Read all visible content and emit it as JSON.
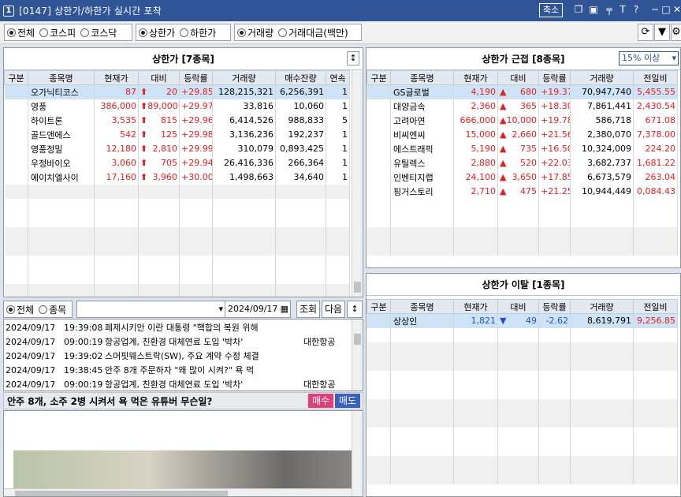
{
  "title": {
    "num": "1",
    "text": "[0147] 상한가/하한가 실시간 포착",
    "shrink": "축소"
  },
  "toolbar": {
    "market": [
      "전체",
      "코스피",
      "코스닥"
    ],
    "kind": [
      "상한가",
      "하한가"
    ],
    "sort": [
      "거래량",
      "거래대금(백만)"
    ]
  },
  "upper": {
    "title": "상한가 [7종목]",
    "cols": [
      "구분",
      "종목명",
      "현재가",
      "대비",
      "등락률",
      "거래량",
      "매수잔량",
      "연속"
    ],
    "rows": [
      [
        "",
        "오가닉티코스",
        "87",
        "20",
        "+29.85",
        "128,215,321",
        "6,256,391",
        "1"
      ],
      [
        "",
        "영풍",
        "386,000",
        "89,000",
        "+29.97",
        "33,816",
        "10,060",
        "1"
      ],
      [
        "",
        "하이트론",
        "3,535",
        "815",
        "+29.96",
        "6,414,526",
        "988,833",
        "5"
      ],
      [
        "",
        "골드앤에스",
        "542",
        "125",
        "+29.98",
        "3,136,236",
        "192,237",
        "1"
      ],
      [
        "",
        "영풍정밀",
        "12,180",
        "2,810",
        "+29.99",
        "310,079",
        "0,893,425",
        "1"
      ],
      [
        "",
        "우정바이오",
        "3,060",
        "705",
        "+29.94",
        "26,416,336",
        "266,364",
        "1"
      ],
      [
        "",
        "에이치엘사이",
        "17,160",
        "3,960",
        "+30.00",
        "1,498,663",
        "34,640",
        "1"
      ]
    ]
  },
  "near": {
    "title": "상한가 근접 [8종목]",
    "filter": "15% 이상",
    "cols": [
      "구분",
      "종목명",
      "현재가",
      "대비",
      "등락률",
      "거래량",
      "전일비"
    ],
    "rows": [
      [
        "",
        "GS글로벌",
        "4,190",
        "680",
        "+19.37",
        "70,947,740",
        "5,455.55"
      ],
      [
        "",
        "대양금속",
        "2,360",
        "365",
        "+18.30",
        "7,861,441",
        "2,430.54"
      ],
      [
        "",
        "고려아연",
        "666,000",
        "10,000",
        "+19.78",
        "586,718",
        "671.08"
      ],
      [
        "",
        "비씨엔씨",
        "15,000",
        "2,660",
        "+21.56",
        "2,380,070",
        "7,378.00"
      ],
      [
        "",
        "에스트래픽",
        "5,190",
        "735",
        "+16.50",
        "10,324,009",
        "224.20"
      ],
      [
        "",
        "유틸렉스",
        "2,880",
        "520",
        "+22.03",
        "3,682,737",
        "1,681.22"
      ],
      [
        "",
        "인벤티지랩",
        "24,100",
        "3,650",
        "+17.85",
        "6,673,579",
        "263.04"
      ],
      [
        "",
        "핑거스토리",
        "2,710",
        "475",
        "+21.25",
        "10,944,449",
        "0,084.43"
      ]
    ]
  },
  "off": {
    "title": "상한가 이탈 [1종목]",
    "cols": [
      "구분",
      "종목명",
      "현재가",
      "대비",
      "등락률",
      "거래량",
      "전일비"
    ],
    "rows": [
      [
        "",
        "상상인",
        "1,821",
        "49",
        "-2.62",
        "8,619,791",
        "9,256.85"
      ]
    ]
  },
  "news": {
    "filter": [
      "전체",
      "종목"
    ],
    "date": "2024/09/17",
    "lookup": "조회",
    "next": "다음",
    "rows": [
      [
        "2024/09/17",
        "19:39:08",
        "페제시키안 이란 대통령 \"핵합의 복원 위해",
        ""
      ],
      [
        "2024/09/17",
        "09:00:19",
        "항공업계, 친환경 대체연료 도입 '박차'",
        "대한항공"
      ],
      [
        "2024/09/17",
        "19:39:02",
        "스머핏웨스트락(SW), 주요 계약 수정 체결",
        ""
      ],
      [
        "2024/09/17",
        "19:38:45",
        "안주 8개 주문하자 \"왜 많이 시켜?\" 욕 먹",
        ""
      ],
      [
        "2024/09/17",
        "09:00:19",
        "항공업계, 친환경 대체연료 도입 '박차'",
        "대한항공"
      ]
    ],
    "headline": "안주 8개, 소주 2병 시켜서 욕 먹은 유튜버 무슨일?",
    "buy": "매수",
    "sell": "매도"
  }
}
